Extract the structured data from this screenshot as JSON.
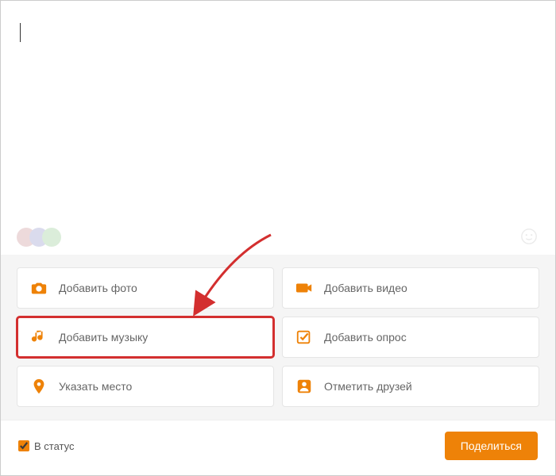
{
  "composer": {
    "placeholder": "",
    "value": ""
  },
  "actions": {
    "add_photo": "Добавить фото",
    "add_video": "Добавить видео",
    "add_music": "Добавить музыку",
    "add_poll": "Добавить опрос",
    "add_place": "Указать место",
    "tag_friends": "Отметить друзей"
  },
  "footer": {
    "status_label": "В статус",
    "status_checked": true,
    "share_label": "Поделиться"
  },
  "colors": {
    "accent": "#ee8208",
    "highlight": "#d32f2f"
  },
  "palette_circles": [
    "#c9999c",
    "#9999cc",
    "#99cc99"
  ]
}
